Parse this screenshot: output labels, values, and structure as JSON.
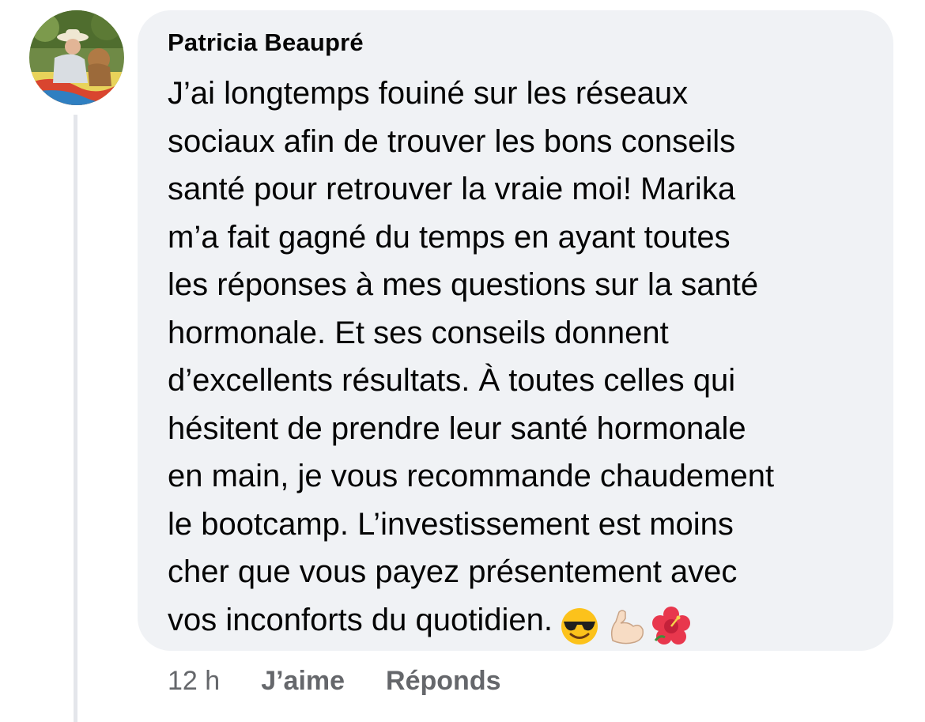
{
  "comment": {
    "author": "Patricia Beaupré",
    "text": "J’ai longtemps fouiné sur les réseaux\nsociaux afin de trouver les bons conseils\nsanté pour retrouver la vraie moi! Marika\nm’a fait gagné du temps en ayant toutes\nles réponses à mes questions sur la santé\nhormonale. Et ses conseils donnent\nd’excellents résultats. À toutes celles qui\nhésitent de prendre leur santé hormonale\nen main, je vous recommande chaudement\nle bootcamp. L’investissement est moins\ncher que vous payez présentement avec\nvos inconforts du quotidien.",
    "emojis": [
      "sunglasses-face-emoji",
      "flexed-biceps-emoji",
      "hibiscus-emoji"
    ],
    "timestamp": "12 h",
    "like_label": "J’aime",
    "reply_label": "Réponds"
  },
  "colors": {
    "bubble_background": "#f0f2f5",
    "text": "#050505",
    "secondary_text": "#65676b",
    "thread_line": "#e4e6eb"
  }
}
